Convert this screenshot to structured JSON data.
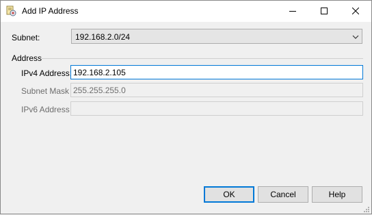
{
  "window": {
    "title": "Add IP Address",
    "icon": "ip-address-app-icon",
    "controls": {
      "minimize_icon": "minimize-icon",
      "maximize_icon": "maximize-icon",
      "close_icon": "close-icon"
    }
  },
  "form": {
    "subnet": {
      "label": "Subnet:",
      "selected": "192.168.2.0/24",
      "icon": "chevron-down-icon"
    },
    "group_label": "Address",
    "ipv4": {
      "label": "IPv4 Address:",
      "value": "192.168.2.105"
    },
    "subnet_mask": {
      "label": "Subnet Mask",
      "value": "255.255.255.0"
    },
    "ipv6": {
      "label": "IPv6 Address",
      "value": ""
    }
  },
  "buttons": {
    "ok": "OK",
    "cancel": "Cancel",
    "help": "Help"
  },
  "colors": {
    "accent": "#0078d7",
    "dialog_bg": "#f0f0f0",
    "disabled_text": "#6d6d6d"
  }
}
